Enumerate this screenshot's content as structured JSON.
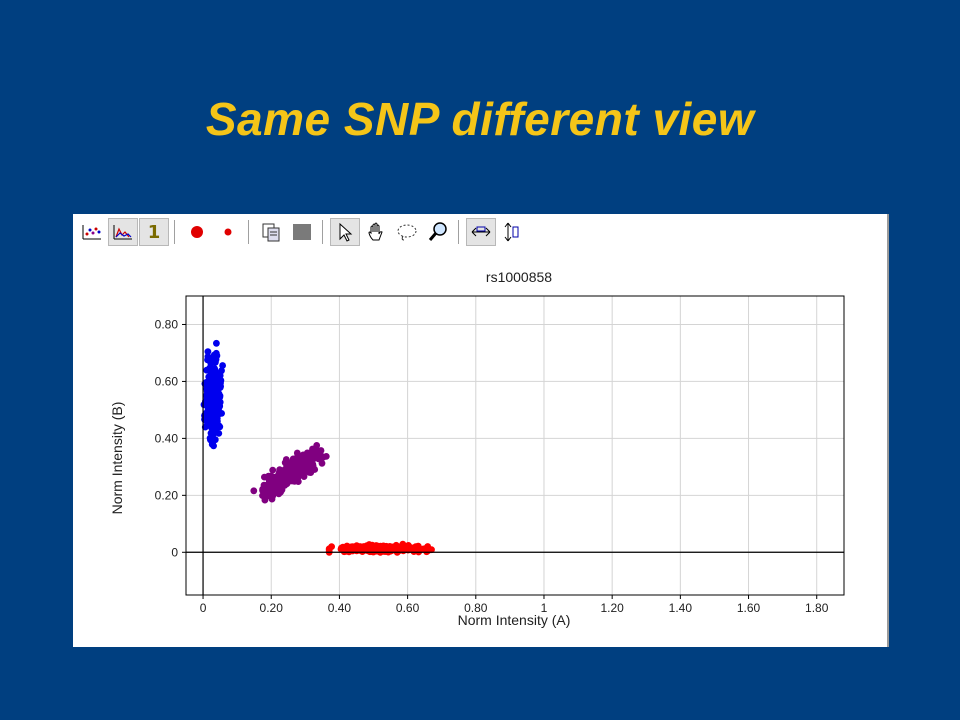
{
  "slide": {
    "title": "Same SNP different view",
    "title_color": "#f5c518",
    "background_color": "#003f80"
  },
  "toolbar": {
    "buttons": [
      {
        "name": "scatter-view-icon",
        "pressed": false
      },
      {
        "name": "bar-view-icon",
        "pressed": true
      },
      {
        "name": "number-one-icon",
        "pressed": true,
        "label": "1"
      },
      {
        "name": "large-dot-icon",
        "pressed": false
      },
      {
        "name": "small-dot-icon",
        "pressed": false
      },
      {
        "name": "copy-icon",
        "pressed": false
      },
      {
        "name": "gray-square-icon",
        "pressed": false
      },
      {
        "name": "pointer-icon",
        "pressed": true
      },
      {
        "name": "hand-pan-icon",
        "pressed": false
      },
      {
        "name": "lasso-icon",
        "pressed": false
      },
      {
        "name": "zoom-icon",
        "pressed": false
      },
      {
        "name": "fit-horizontal-icon",
        "pressed": true
      },
      {
        "name": "fit-vertical-icon",
        "pressed": false
      }
    ]
  },
  "chart_data": {
    "type": "scatter",
    "title": "rs1000858",
    "xlabel": "Norm Intensity (A)",
    "ylabel": "Norm Intensity (B)",
    "xlim": [
      -0.05,
      1.88
    ],
    "ylim": [
      -0.15,
      0.9
    ],
    "x_ticks": [
      0,
      0.2,
      0.4,
      0.6,
      0.8,
      1,
      1.2,
      1.4,
      1.6,
      1.8
    ],
    "x_tick_labels": [
      "0",
      "0.20",
      "0.40",
      "0.60",
      "0.80",
      "1",
      "1.20",
      "1.40",
      "1.60",
      "1.80"
    ],
    "y_ticks": [
      0,
      0.2,
      0.4,
      0.6,
      0.8
    ],
    "y_tick_labels": [
      "0",
      "0.20",
      "0.40",
      "0.60",
      "0.80"
    ],
    "grid": true,
    "zero_lines": true,
    "series": [
      {
        "color": "#0000ee",
        "n": 260,
        "x_range": [
          0.0,
          0.06
        ],
        "y_center": 0.54,
        "y_range": [
          0.33,
          0.75
        ],
        "spread": [
          0.012,
          0.07
        ],
        "corr": 0
      },
      {
        "color": "#800080",
        "n": 300,
        "x_range": [
          0.14,
          0.37
        ],
        "y_center": 0.28,
        "y_range": [
          0.16,
          0.38
        ],
        "x_center": 0.26,
        "spread": [
          0.04,
          0.035
        ],
        "corr": 0.8
      },
      {
        "color": "#ff0000",
        "n": 220,
        "x_range": [
          0.37,
          0.67
        ],
        "y_center": 0.012,
        "y_range": [
          0.0,
          0.03
        ],
        "spread": [
          0.065,
          0.006
        ],
        "corr": 0
      }
    ]
  }
}
